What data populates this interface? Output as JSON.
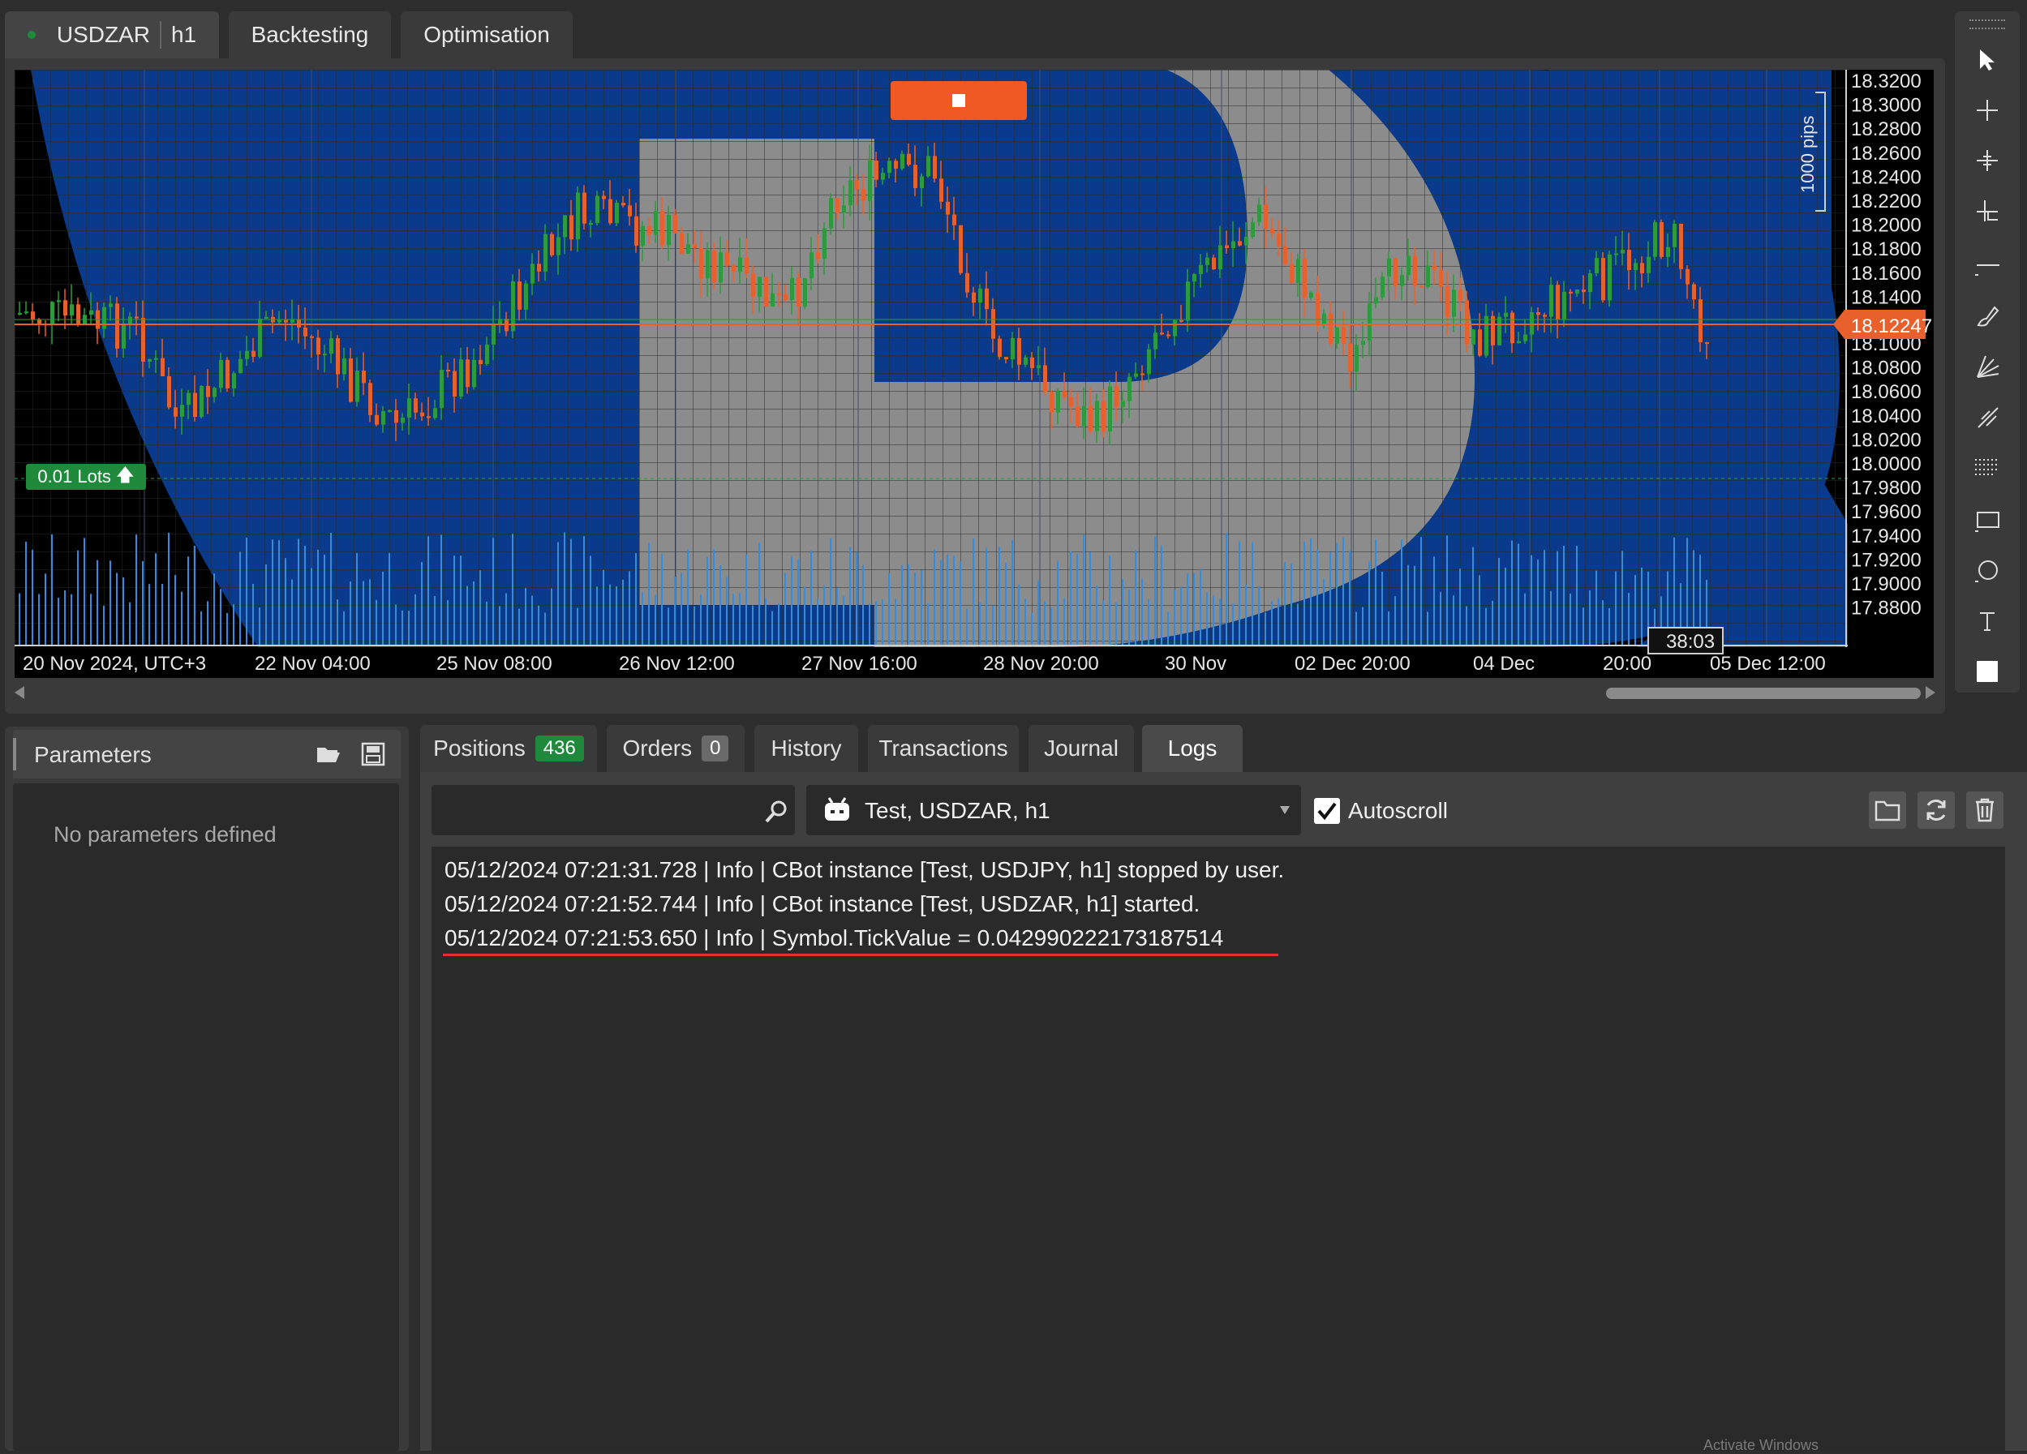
{
  "top_tabs": {
    "symbol": "USDZAR",
    "timeframe": "h1",
    "backtesting": "Backtesting",
    "optimisation": "Optimisation"
  },
  "chart": {
    "stop_button_icon": "stop-icon",
    "lots_label": "0.01 Lots",
    "current_price": "18.12247",
    "pips_label": "1000 pips",
    "countdown": "38:03",
    "price_ticks": [
      "18.3200",
      "18.3000",
      "18.2800",
      "18.2600",
      "18.2400",
      "18.2200",
      "18.2000",
      "18.1800",
      "18.1600",
      "18.1400",
      "18.1000",
      "18.0800",
      "18.0600",
      "18.0400",
      "18.0200",
      "18.0000",
      "17.9800",
      "17.9600",
      "17.9400",
      "17.9200",
      "17.9000",
      "17.8800"
    ],
    "time_ticks": [
      "20 Nov 2024, UTC+3",
      "22 Nov 04:00",
      "25 Nov 08:00",
      "26 Nov 12:00",
      "27 Nov 16:00",
      "28 Nov 20:00",
      "30 Nov",
      "02 Dec 20:00",
      "04 Dec",
      "20:00",
      "05 Dec 12:00"
    ],
    "colors": {
      "bull": "#2e9a3e",
      "bear": "#e8612c",
      "background": "#0a3a8c",
      "price_line": "#e8612c"
    }
  },
  "toolbar": {
    "tools": [
      "cursor-icon",
      "crosshair-icon",
      "price-crosshair-icon",
      "measure-icon",
      "horizontal-line-icon",
      "brush-icon",
      "fan-icon",
      "pitchfork-icon",
      "fibonacci-icon",
      "rectangle-icon",
      "ellipse-icon",
      "text-icon",
      "color-square-icon"
    ]
  },
  "parameters": {
    "title": "Parameters",
    "empty_text": "No parameters defined"
  },
  "bottom_tabs": {
    "positions": "Positions",
    "positions_count": "436",
    "orders": "Orders",
    "orders_count": "0",
    "history": "History",
    "transactions": "Transactions",
    "journal": "Journal",
    "logs": "Logs"
  },
  "logs": {
    "search_value": "",
    "instance_select": "Test, USDZAR, h1",
    "autoscroll": "Autoscroll",
    "lines": [
      "05/12/2024 07:21:31.728 | Info | CBot instance [Test, USDJPY, h1] stopped by user.",
      "05/12/2024 07:21:52.744 | Info | CBot instance [Test, USDZAR, h1] started.",
      "05/12/2024 07:21:53.650 | Info | Symbol.TickValue = 0.042990222173187514"
    ],
    "watermark": "Activate Windows"
  }
}
